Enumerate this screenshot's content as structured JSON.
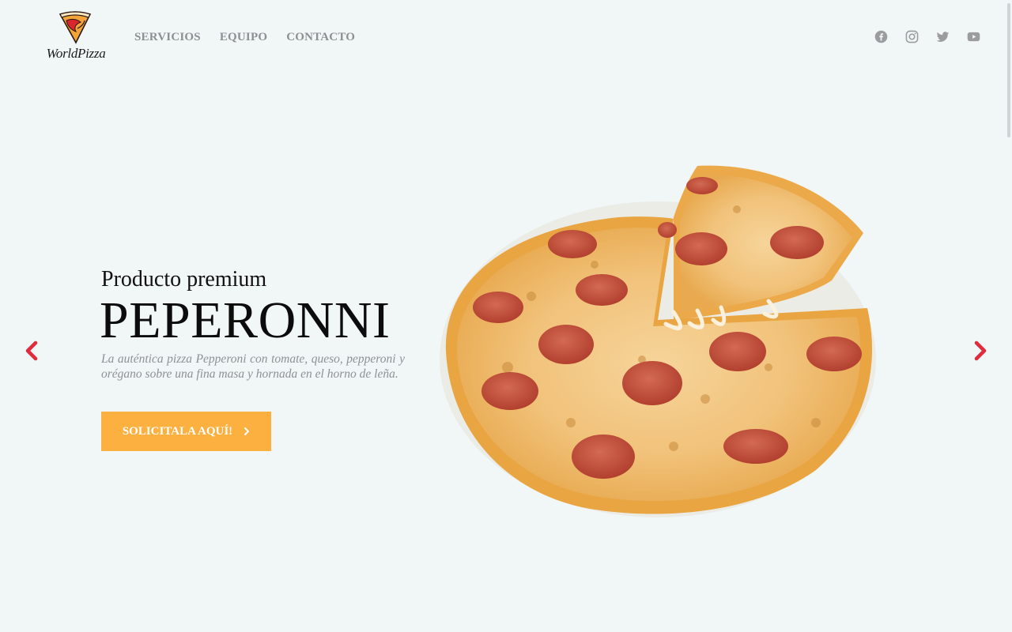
{
  "brand": {
    "logo_text": "WorldPizza"
  },
  "nav": {
    "items": [
      {
        "label": "SERVICIOS"
      },
      {
        "label": "EQUIPO"
      },
      {
        "label": "CONTACTO"
      }
    ]
  },
  "socials": [
    "facebook-icon",
    "instagram-icon",
    "twitter-icon",
    "youtube-icon"
  ],
  "hero": {
    "subtitle": "Producto premium",
    "title": "PEPERONNI",
    "description": "La auténtica pizza Pepperoni con tomate, queso, pepperoni y orégano sobre una fina masa y hornada en el horno de leña.",
    "cta_label": "SOLICITALA AQUÍ!"
  },
  "colors": {
    "background": "#f1f6f7",
    "accent": "#fbb040",
    "arrow": "#e02b3a",
    "nav_text": "#8d8f91"
  }
}
